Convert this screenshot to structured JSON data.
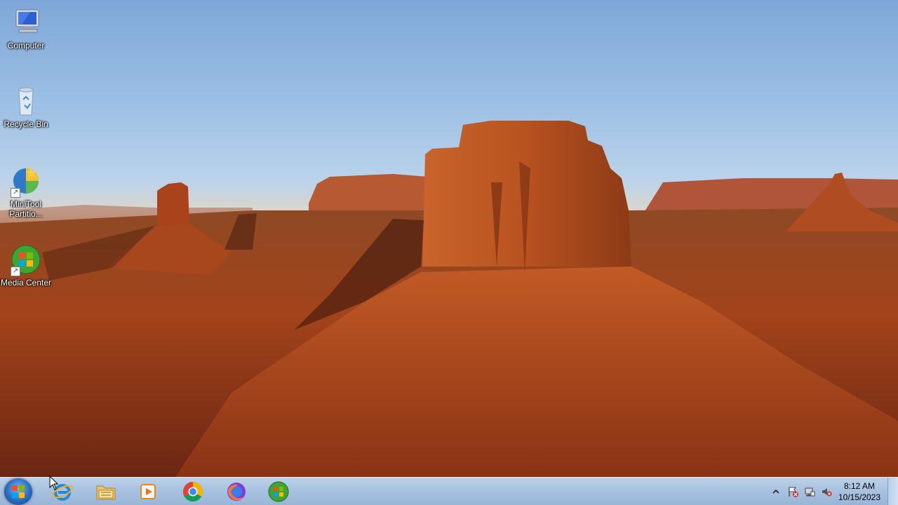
{
  "desktop": {
    "icons": [
      {
        "label": "Computer",
        "icon": "computer-icon"
      },
      {
        "label": "Recycle Bin",
        "icon": "recycle-bin-icon"
      },
      {
        "label": "MiniTool Partitio...",
        "icon": "minitool-partition-icon"
      },
      {
        "label": "Media Center",
        "icon": "media-center-icon"
      }
    ]
  },
  "taskbar": {
    "start_button": "start-orb",
    "pinned": [
      {
        "name": "Internet Explorer",
        "icon": "internet-explorer-icon"
      },
      {
        "name": "Windows Explorer",
        "icon": "folder-explorer-icon"
      },
      {
        "name": "Windows Media Player",
        "icon": "media-player-icon"
      },
      {
        "name": "Google Chrome",
        "icon": "chrome-icon"
      },
      {
        "name": "Firefox",
        "icon": "firefox-icon"
      },
      {
        "name": "Media Center",
        "icon": "media-center-icon"
      }
    ],
    "tray": {
      "icons": [
        "show-hidden-icons-chevron",
        "action-center-flag-icon",
        "network-icon",
        "volume-muted-icon"
      ],
      "time": "8:12 AM",
      "date": "10/15/2023"
    }
  },
  "colors": {
    "taskbar": "#a9c2e0",
    "sky": "#7ea7d8",
    "rock": "#a8461f"
  }
}
